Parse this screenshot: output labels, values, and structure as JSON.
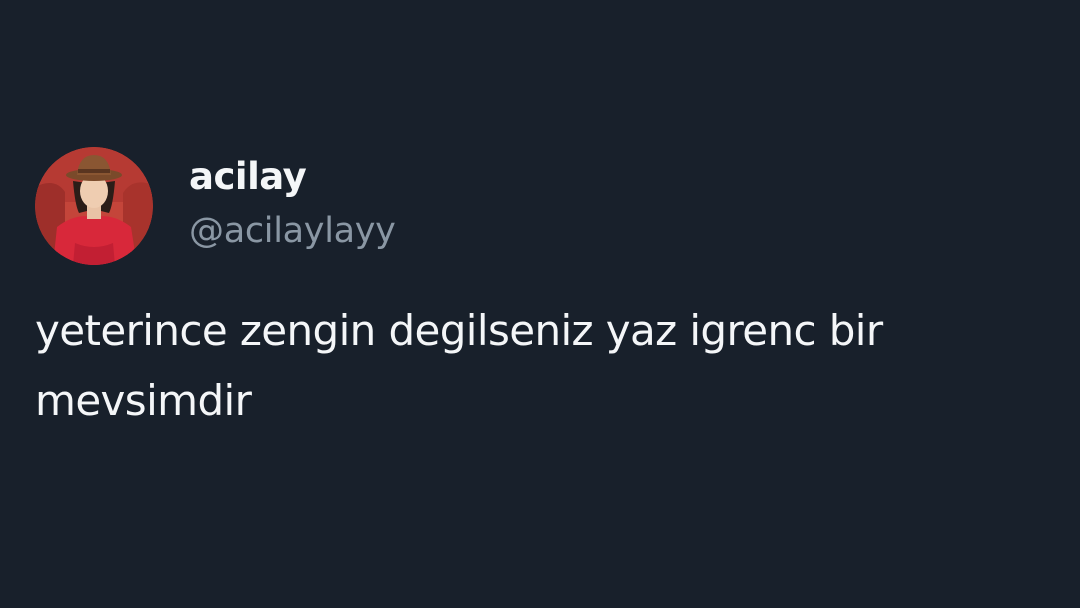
{
  "tweet": {
    "author": {
      "display_name": "acilay",
      "handle": "@acilaylayy",
      "avatar_icon": "profile-photo"
    },
    "text_lines": [
      "yeterince zengin degilseniz yaz igrenc bir",
      "mevsimdir"
    ]
  },
  "colors": {
    "background": "#18202b",
    "primary_text": "#f4f6f8",
    "secondary_text": "#8a97a4"
  }
}
